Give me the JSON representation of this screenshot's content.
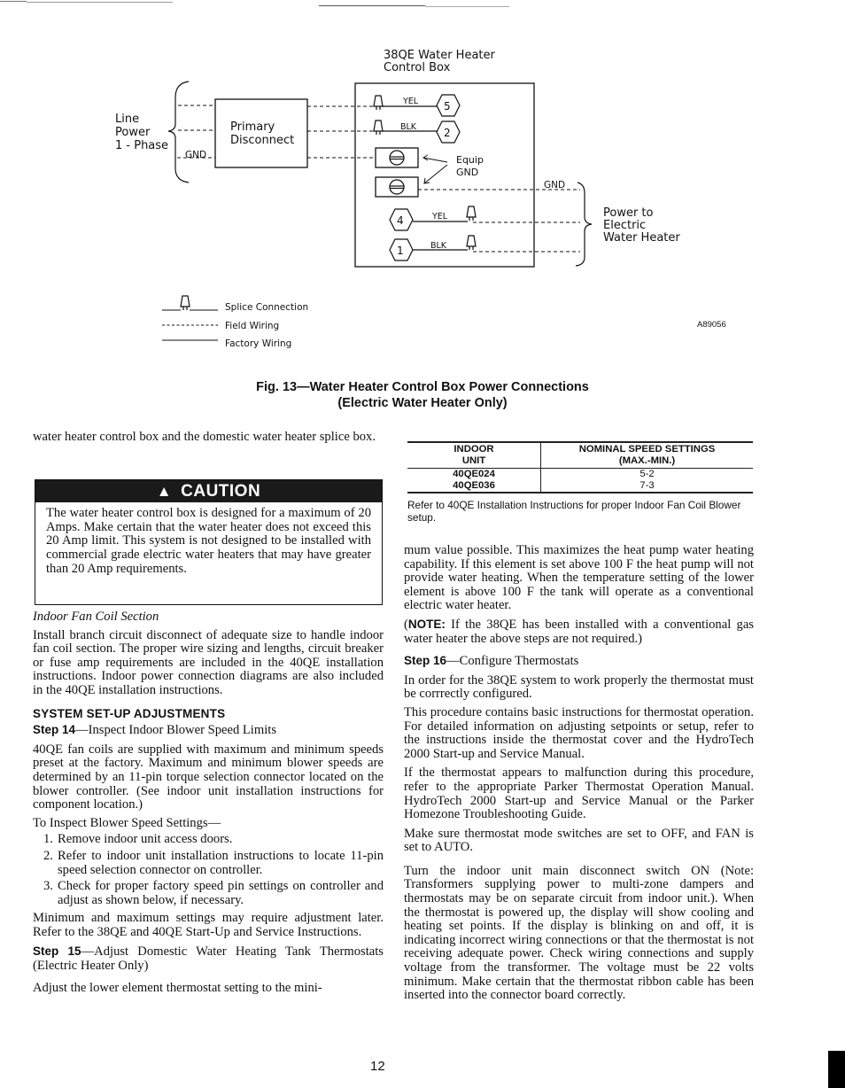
{
  "diagram": {
    "control_box_title_line1": "38QE Water Heater",
    "control_box_title_line2": "Control Box",
    "line_power_label": [
      "Line",
      "Power",
      "1 - Phase"
    ],
    "line_gnd_label": "GND",
    "primary_disconnect_label": [
      "Primary",
      "Disconnect"
    ],
    "upper_wires": [
      {
        "color_label": "YEL",
        "terminal": "5"
      },
      {
        "color_label": "BLK",
        "terminal": "2"
      }
    ],
    "lower_wires": [
      {
        "color_label": "YEL",
        "terminal": "4"
      },
      {
        "color_label": "BLK",
        "terminal": "1"
      }
    ],
    "equip_gnd_label": [
      "Equip",
      "GND"
    ],
    "out_gnd_label": "GND",
    "power_to_label": [
      "Power to",
      "Electric",
      "Water Heater"
    ],
    "legend": [
      {
        "symbol": "splice",
        "label": "Splice Connection"
      },
      {
        "symbol": "dashed",
        "label": "Field Wiring"
      },
      {
        "symbol": "solid",
        "label": "Factory Wiring"
      }
    ],
    "figure_code": "A89056"
  },
  "figure_caption": {
    "line1": "Fig. 13—Water Heater Control Box Power Connections",
    "line2": "(Electric Water Heater Only)"
  },
  "left_column": {
    "intro": "water heater control box and the domestic water heater splice box.",
    "caution": {
      "icon": "warning-triangle",
      "title": "CAUTION",
      "body": "The water heater control box is designed for a maximum of 20 Amps. Make certain that the water heater does not exceed this 20 Amp limit. This system is not designed to be installed with commercial grade electric water heaters that may have greater than 20 Amp requirements."
    },
    "indoor_heading": "Indoor Fan Coil Section",
    "indoor_body": "Install branch circuit disconnect of adequate size to handle indoor fan coil section. The proper wire sizing and lengths, circuit breaker or fuse amp requirements are included in the 40QE installation instructions. Indoor power connection diagrams are also included in the 40QE installation instructions.",
    "system_heading": "SYSTEM SET-UP ADJUSTMENTS",
    "step14_label": "Step 14",
    "step14_title": "—Inspect Indoor Blower Speed Limits",
    "step14_body": "40QE fan coils are supplied with maximum and minimum speeds preset at the factory. Maximum and minimum blower speeds are determined by an 11-pin torque selection connector located on the blower controller. (See indoor unit installation instructions for component location.)",
    "inspect_intro": "To Inspect Blower Speed Settings—",
    "steps": [
      {
        "num": "1.",
        "text": "Remove indoor unit access doors."
      },
      {
        "num": "2.",
        "text": "Refer to indoor unit installation instructions to locate 11-pin speed selection connector on controller."
      },
      {
        "num": "3.",
        "text": "Check for proper factory speed pin settings on controller and adjust as shown below, if necessary."
      }
    ],
    "adjust_note": "Minimum and maximum settings may require adjustment later. Refer to the 38QE and 40QE Start-Up and Service Instructions.",
    "step15_label": "Step 15",
    "step15_title": "—Adjust Domestic Water Heating Tank Thermostats (Electric Heater Only)",
    "step15_body": "Adjust the lower element thermostat setting to the mini-"
  },
  "speed_table": {
    "headers": [
      [
        "INDOOR",
        "UNIT"
      ],
      [
        "NOMINAL SPEED SETTINGS",
        "(MAX.-MIN.)"
      ]
    ],
    "rows": [
      {
        "unit": "40QE024",
        "setting": "5-2"
      },
      {
        "unit": "40QE036",
        "setting": "7-3"
      }
    ],
    "note": "Refer to 40QE Installation Instructions for proper Indoor Fan Coil Blower setup."
  },
  "right_column": {
    "p1": "mum value possible. This maximizes the heat pump water heating capability. If this element is set above 100 F the heat pump will not provide water heating. When the temperature setting of the lower element is above 100 F the tank will operate as a conventional electric water heater.",
    "note_label": "NOTE:",
    "note_prefix": "(",
    "note_body": " If the 38QE has been installed with a conventional gas water heater the above steps are not required.)",
    "step16_label": "Step 16",
    "step16_title": "—Configure Thermostats",
    "p2": "In order for the 38QE system to work properly the thermostat must be corrrectly configured.",
    "p3": "This procedure contains basic instructions for thermostat operation. For detailed information on adjusting setpoints or setup, refer to the instructions inside the thermostat cover and the HydroTech 2000 Start-up and Service Manual.",
    "p4": "If the thermostat appears to malfunction during this procedure, refer to the appropriate Parker Thermostat Operation Manual. HydroTech 2000 Start-up and Service Manual or the Parker Homezone Troubleshooting Guide.",
    "p5": "Make sure thermostat mode switches are set to OFF, and FAN is set to AUTO.",
    "p6": "Turn the indoor unit main disconnect switch ON (Note: Transformers supplying power to multi-zone dampers and thermostats may be on separate circuit from indoor unit.). When the thermostat is powered up, the display will show cooling and heating set points. If the display is blinking on and off, it is indicating incorrect wiring connections or that the thermostat is not receiving adequate power. Check wiring connections and supply voltage from the transformer. The voltage must be 22 volts minimum. Make certain that the thermostat ribbon cable has been inserted into the connector board correctly."
  },
  "page_number": "12"
}
